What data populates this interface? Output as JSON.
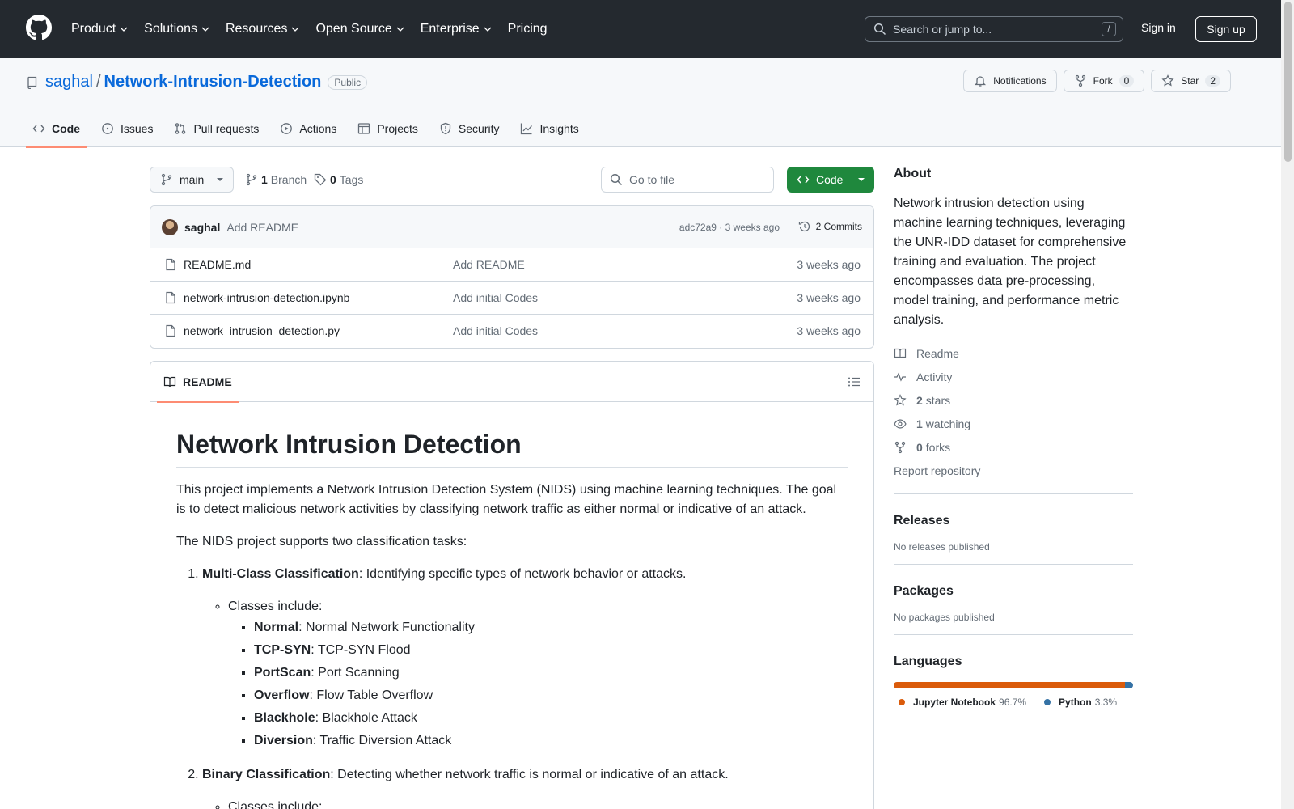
{
  "header": {
    "nav": [
      {
        "label": "Product"
      },
      {
        "label": "Solutions"
      },
      {
        "label": "Resources"
      },
      {
        "label": "Open Source"
      },
      {
        "label": "Enterprise"
      },
      {
        "label": "Pricing"
      }
    ],
    "search_placeholder": "Search or jump to...",
    "search_shortcut": "/",
    "signin": "Sign in",
    "signup": "Sign up"
  },
  "repo": {
    "owner": "saghal",
    "separator": "/",
    "name": "Network-Intrusion-Detection",
    "visibility": "Public",
    "notifications_label": "Notifications",
    "fork_label": "Fork",
    "fork_count": "0",
    "star_label": "Star",
    "star_count": "2",
    "tabs": [
      {
        "label": "Code"
      },
      {
        "label": "Issues"
      },
      {
        "label": "Pull requests"
      },
      {
        "label": "Actions"
      },
      {
        "label": "Projects"
      },
      {
        "label": "Security"
      },
      {
        "label": "Insights"
      }
    ]
  },
  "toolbar": {
    "branch": "main",
    "branch_count": "1",
    "branch_label": "Branch",
    "tag_count": "0",
    "tag_label": "Tags",
    "goto_placeholder": "Go to file",
    "code_button": "Code"
  },
  "commit": {
    "author": "saghal",
    "message": "Add README",
    "meta": "adc72a9 · 3 weeks ago",
    "count": "2 Commits"
  },
  "files": [
    {
      "name": "README.md",
      "message": "Add README",
      "age": "3 weeks ago"
    },
    {
      "name": "network-intrusion-detection.ipynb",
      "message": "Add initial Codes",
      "age": "3 weeks ago"
    },
    {
      "name": "network_intrusion_detection.py",
      "message": "Add initial Codes",
      "age": "3 weeks ago"
    }
  ],
  "readme": {
    "tab_label": "README",
    "title": "Network Intrusion Detection",
    "intro": "This project implements a Network Intrusion Detection System (NIDS) using machine learning techniques. The goal is to detect malicious network activities by classifying network traffic as either normal or indicative of an attack.",
    "tasks_intro": "The NIDS project supports two classification tasks:",
    "task1_title": "Multi-Class Classification",
    "task1_desc": ": Identifying specific types of network behavior or attacks.",
    "classes_include": "Classes include:",
    "classes": [
      {
        "name": "Normal",
        "desc": ": Normal Network Functionality"
      },
      {
        "name": "TCP-SYN",
        "desc": ": TCP-SYN Flood"
      },
      {
        "name": "PortScan",
        "desc": ": Port Scanning"
      },
      {
        "name": "Overflow",
        "desc": ": Flow Table Overflow"
      },
      {
        "name": "Blackhole",
        "desc": ": Blackhole Attack"
      },
      {
        "name": "Diversion",
        "desc": ": Traffic Diversion Attack"
      }
    ],
    "task2_title": "Binary Classification",
    "task2_desc": ": Detecting whether network traffic is normal or indicative of an attack.",
    "classes_include_2": "Classes include:"
  },
  "sidebar": {
    "about_title": "About",
    "about_desc": "Network intrusion detection using machine learning techniques, leveraging the UNR-IDD dataset for comprehensive training and evaluation. The project encompasses data pre-processing, model training, and performance metric analysis.",
    "readme_link": "Readme",
    "activity_link": "Activity",
    "stars_count": "2",
    "stars_label": "stars",
    "watching_count": "1",
    "watching_label": "watching",
    "forks_count": "0",
    "forks_label": "forks",
    "report": "Report repository",
    "releases_title": "Releases",
    "releases_text": "No releases published",
    "packages_title": "Packages",
    "packages_text": "No packages published",
    "languages_title": "Languages",
    "languages": [
      {
        "name": "Jupyter Notebook",
        "pct": "96.7%",
        "share": 96.7,
        "color": "#DA5B0B"
      },
      {
        "name": "Python",
        "pct": "3.3%",
        "share": 3.3,
        "color": "#3572A5"
      }
    ]
  },
  "colors": {
    "header_bg": "#24292f",
    "link": "#0969da",
    "code_button": "#1f883d",
    "active_tab": "#fd8c73"
  }
}
